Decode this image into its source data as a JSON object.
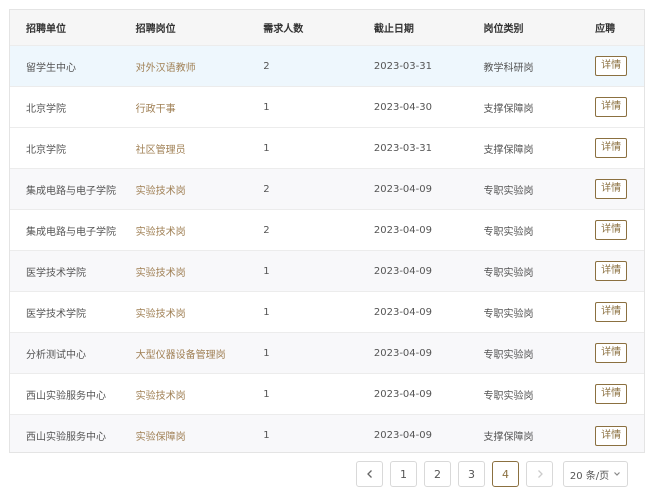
{
  "table": {
    "headers": {
      "unit": "招聘单位",
      "post": "招聘岗位",
      "count": "需求人数",
      "deadline": "截止日期",
      "category": "岗位类别",
      "action": "应聘"
    },
    "rows": [
      {
        "unit": "留学生中心",
        "post": "对外汉语教师",
        "count": "2",
        "deadline": "2023-03-31",
        "category": "教学科研岗",
        "action": "详情"
      },
      {
        "unit": "北京学院",
        "post": "行政干事",
        "count": "1",
        "deadline": "2023-04-30",
        "category": "支撑保障岗",
        "action": "详情"
      },
      {
        "unit": "北京学院",
        "post": "社区管理员",
        "count": "1",
        "deadline": "2023-03-31",
        "category": "支撑保障岗",
        "action": "详情"
      },
      {
        "unit": "集成电路与电子学院",
        "post": "实验技术岗",
        "count": "2",
        "deadline": "2023-04-09",
        "category": "专职实验岗",
        "action": "详情"
      },
      {
        "unit": "集成电路与电子学院",
        "post": "实验技术岗",
        "count": "2",
        "deadline": "2023-04-09",
        "category": "专职实验岗",
        "action": "详情"
      },
      {
        "unit": "医学技术学院",
        "post": "实验技术岗",
        "count": "1",
        "deadline": "2023-04-09",
        "category": "专职实验岗",
        "action": "详情"
      },
      {
        "unit": "医学技术学院",
        "post": "实验技术岗",
        "count": "1",
        "deadline": "2023-04-09",
        "category": "专职实验岗",
        "action": "详情"
      },
      {
        "unit": "分析测试中心",
        "post": "大型仪器设备管理岗",
        "count": "1",
        "deadline": "2023-04-09",
        "category": "专职实验岗",
        "action": "详情"
      },
      {
        "unit": "西山实验服务中心",
        "post": "实验技术岗",
        "count": "1",
        "deadline": "2023-04-09",
        "category": "专职实验岗",
        "action": "详情"
      },
      {
        "unit": "西山实验服务中心",
        "post": "实验保障岗",
        "count": "1",
        "deadline": "2023-04-09",
        "category": "支撑保障岗",
        "action": "详情"
      }
    ]
  },
  "pagination": {
    "prev_icon": "chevron-left-icon",
    "next_icon": "chevron-right-icon",
    "pages": [
      "1",
      "2",
      "3",
      "4"
    ],
    "current_page": "4",
    "page_size": "20 条/页"
  }
}
